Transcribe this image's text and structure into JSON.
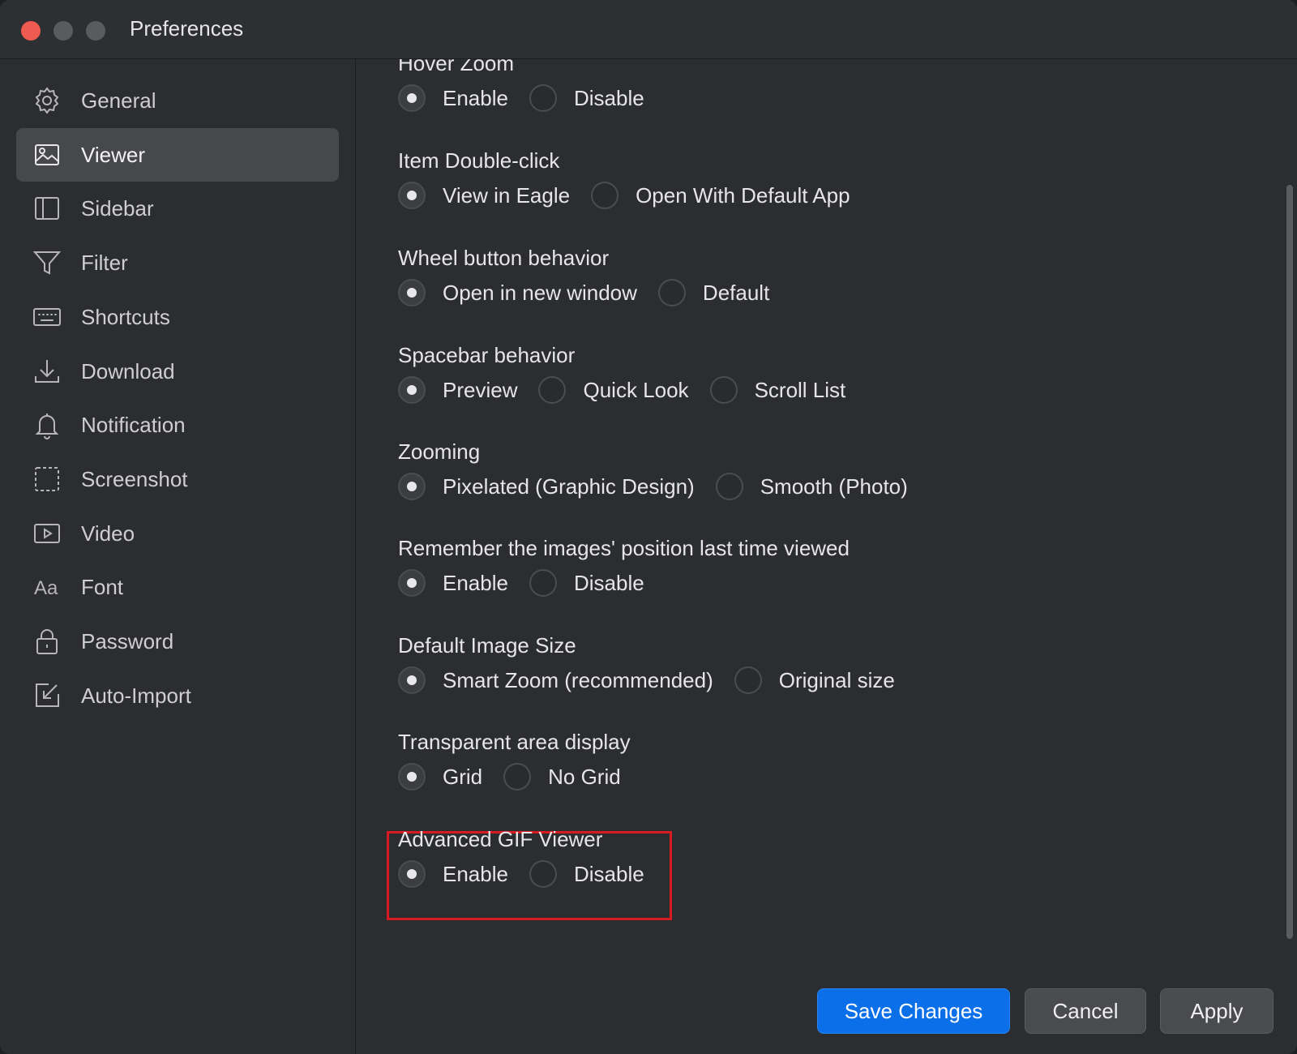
{
  "window": {
    "title": "Preferences"
  },
  "colors": {
    "accent": "#0a6fe8",
    "highlight_border": "#d81b21",
    "close": "#ee5b50"
  },
  "sidebar": {
    "items": [
      {
        "label": "General",
        "icon": "gear-icon",
        "active": false
      },
      {
        "label": "Viewer",
        "icon": "image-icon",
        "active": true
      },
      {
        "label": "Sidebar",
        "icon": "sidebar-icon",
        "active": false
      },
      {
        "label": "Filter",
        "icon": "filter-icon",
        "active": false
      },
      {
        "label": "Shortcuts",
        "icon": "keyboard-icon",
        "active": false
      },
      {
        "label": "Download",
        "icon": "download-icon",
        "active": false
      },
      {
        "label": "Notification",
        "icon": "bell-icon",
        "active": false
      },
      {
        "label": "Screenshot",
        "icon": "screenshot-icon",
        "active": false
      },
      {
        "label": "Video",
        "icon": "video-icon",
        "active": false
      },
      {
        "label": "Font",
        "icon": "font-icon",
        "active": false,
        "icon_text": "Aa"
      },
      {
        "label": "Password",
        "icon": "lock-icon",
        "active": false
      },
      {
        "label": "Auto-Import",
        "icon": "import-icon",
        "active": false
      }
    ]
  },
  "settings": [
    {
      "title": "Hover Zoom",
      "options": [
        "Enable",
        "Disable"
      ],
      "selected": 0
    },
    {
      "title": "Item Double-click",
      "options": [
        "View in Eagle",
        "Open With Default App"
      ],
      "selected": 0
    },
    {
      "title": "Wheel button behavior",
      "options": [
        "Open in new window",
        "Default"
      ],
      "selected": 0
    },
    {
      "title": "Spacebar behavior",
      "options": [
        "Preview",
        "Quick Look",
        "Scroll List"
      ],
      "selected": 0
    },
    {
      "title": "Zooming",
      "options": [
        "Pixelated (Graphic Design)",
        "Smooth (Photo)"
      ],
      "selected": 0
    },
    {
      "title": "Remember the images' position last time viewed",
      "options": [
        "Enable",
        "Disable"
      ],
      "selected": 0
    },
    {
      "title": "Default Image Size",
      "options": [
        "Smart Zoom (recommended)",
        "Original size"
      ],
      "selected": 0
    },
    {
      "title": "Transparent area display",
      "options": [
        "Grid",
        "No Grid"
      ],
      "selected": 0
    },
    {
      "title": "Advanced GIF Viewer",
      "options": [
        "Enable",
        "Disable"
      ],
      "selected": 0,
      "highlighted": true
    }
  ],
  "buttons": {
    "save": "Save Changes",
    "cancel": "Cancel",
    "apply": "Apply"
  }
}
